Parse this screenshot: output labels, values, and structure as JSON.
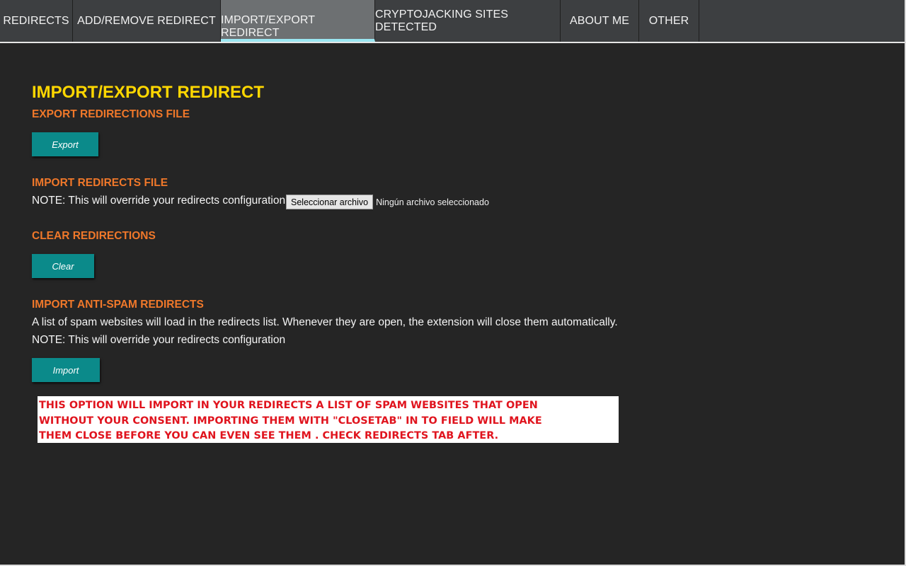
{
  "tabs": [
    {
      "label": "REDIRECTS",
      "active": false
    },
    {
      "label": "ADD/REMOVE REDIRECT",
      "active": false
    },
    {
      "label": "IMPORT/EXPORT REDIRECT",
      "active": true
    },
    {
      "label": "CRYPTOJACKING SITES DETECTED",
      "active": false
    },
    {
      "label": "ABOUT ME",
      "active": false
    },
    {
      "label": "OTHER",
      "active": false
    }
  ],
  "page_title": "IMPORT/EXPORT REDIRECT",
  "export_section": {
    "title": "EXPORT REDIRECTIONS FILE",
    "button_label": "Export"
  },
  "import_section": {
    "title": "IMPORT REDIRECTS FILE",
    "note": "NOTE: This will override your redirects configuration",
    "file_button_label": "Seleccionar archivo",
    "file_status": "Ningún archivo seleccionado"
  },
  "clear_section": {
    "title": "CLEAR REDIRECTIONS",
    "button_label": "Clear"
  },
  "antispam_section": {
    "title": "IMPORT ANTI-SPAM REDIRECTS",
    "description": "A list of spam websites will load in the redirects list. Whenever they are open, the extension will close them automatically.",
    "note": "NOTE: This will override your redirects configuration",
    "button_label": "Import"
  },
  "warning": {
    "lines": [
      "THIS OPTION WILL IMPORT IN YOUR REDIRECTS A LIST OF SPAM WEBSITES THAT OPEN",
      "WITHOUT YOUR CONSENT. IMPORTING THEM WITH \"CLOSETAB\" IN TO FIELD WILL MAKE",
      "THEM CLOSE BEFORE YOU CAN EVEN SEE THEM . CHECK REDIRECTS TAB AFTER."
    ]
  },
  "colors": {
    "background": "#252525",
    "tabbar": "#3d3f41",
    "active_tab": "#6d7072",
    "active_underline": "#9be7f2",
    "title_yellow": "#ffd700",
    "section_orange": "#f0782a",
    "button_teal": "#0b8a8a",
    "warning_red": "#e0141e"
  }
}
